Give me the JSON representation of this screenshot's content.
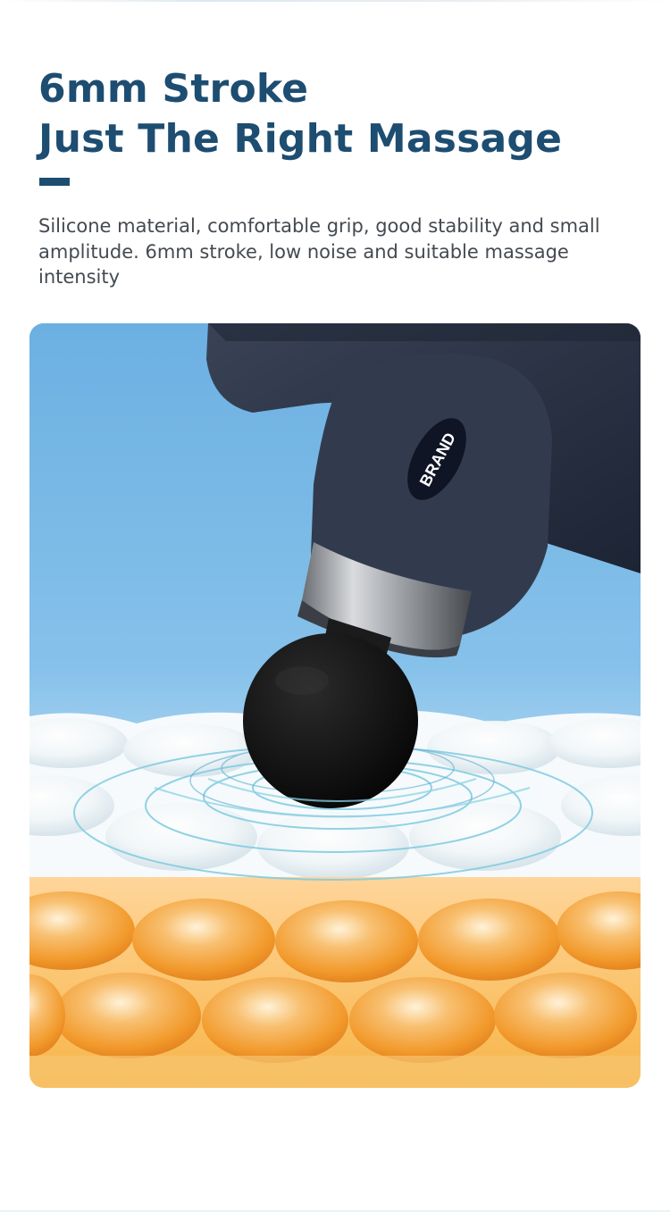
{
  "headline": {
    "line1": "6mm Stroke",
    "line2": "Just The Right Massage"
  },
  "description": "Silicone material, comfortable grip, good stability and small amplitude. 6mm stroke, low noise and suitable massage intensity",
  "product": {
    "brand_label": "BRAND"
  },
  "colors": {
    "heading": "#1d4d71",
    "body_text": "#444a50",
    "device_body": "#2a3244",
    "massage_head": "#141414",
    "sky": "#7dbbe8",
    "cells": "#f4a63c"
  }
}
